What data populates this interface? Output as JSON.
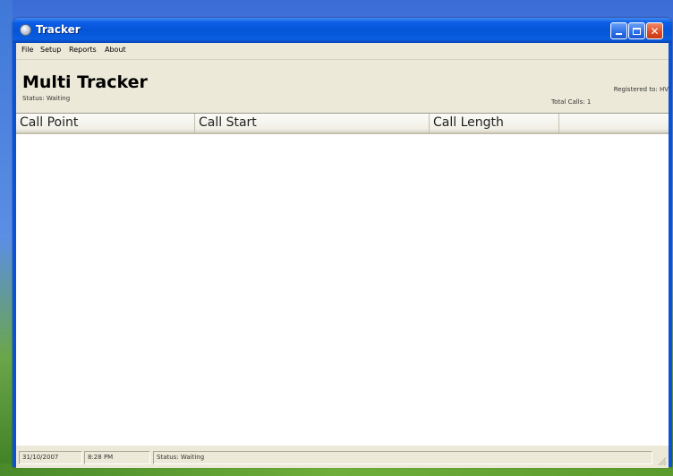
{
  "window": {
    "title": "Tracker"
  },
  "menu": {
    "items": [
      "File",
      "Setup",
      "Reports",
      "About"
    ]
  },
  "header": {
    "app_title": "Multi Tracker",
    "status": "Status: Waiting",
    "registered": "Registered to: HV",
    "total_calls": "Total Calls: 1"
  },
  "table": {
    "columns": [
      "Call Point",
      "Call Start",
      "Call Length"
    ]
  },
  "statusbar": {
    "date": "31/10/2007",
    "time": "8:28 PM",
    "status": "Status: Waiting"
  },
  "icons": {
    "app": "tracker-app-icon",
    "minimize": "minimize-icon",
    "maximize": "maximize-icon",
    "close": "close-icon"
  }
}
